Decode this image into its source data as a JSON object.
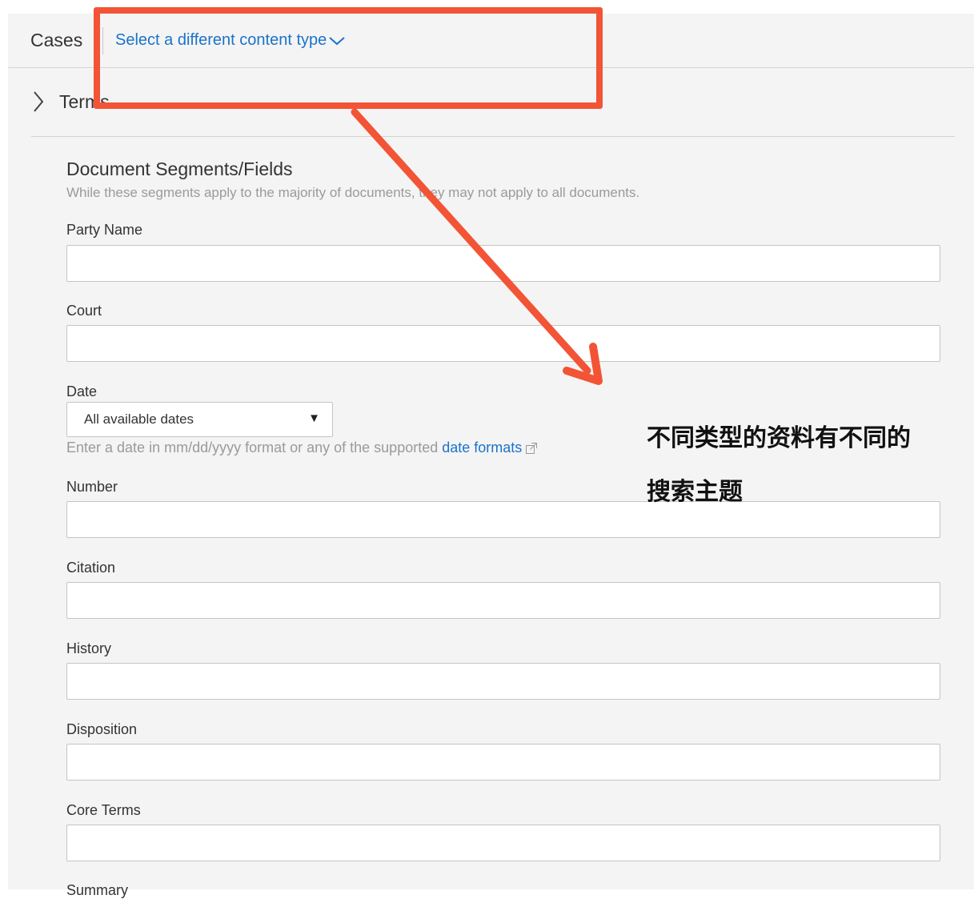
{
  "header": {
    "content_type": "Cases",
    "select_link": "Select a different content type"
  },
  "terms": {
    "label": "Terms"
  },
  "segments": {
    "title": "Document Segments/Fields",
    "description": "While these segments apply to the majority of documents, they may not apply to all documents."
  },
  "fields": {
    "party_name": "Party Name",
    "court": "Court",
    "date": "Date",
    "number": "Number",
    "citation": "Citation",
    "history": "History",
    "disposition": "Disposition",
    "core_terms": "Core Terms",
    "summary": "Summary"
  },
  "date_select": {
    "selected": "All available dates"
  },
  "date_hint": {
    "text": "Enter a date in mm/dd/yyyy format or any of the supported",
    "link": "date formats"
  },
  "annotation": {
    "line1": "不同类型的资料有不同的",
    "line2": "搜索主题",
    "color": "#f25435"
  },
  "colors": {
    "link": "#1a73c9",
    "panel_bg": "#f4f4f4"
  }
}
